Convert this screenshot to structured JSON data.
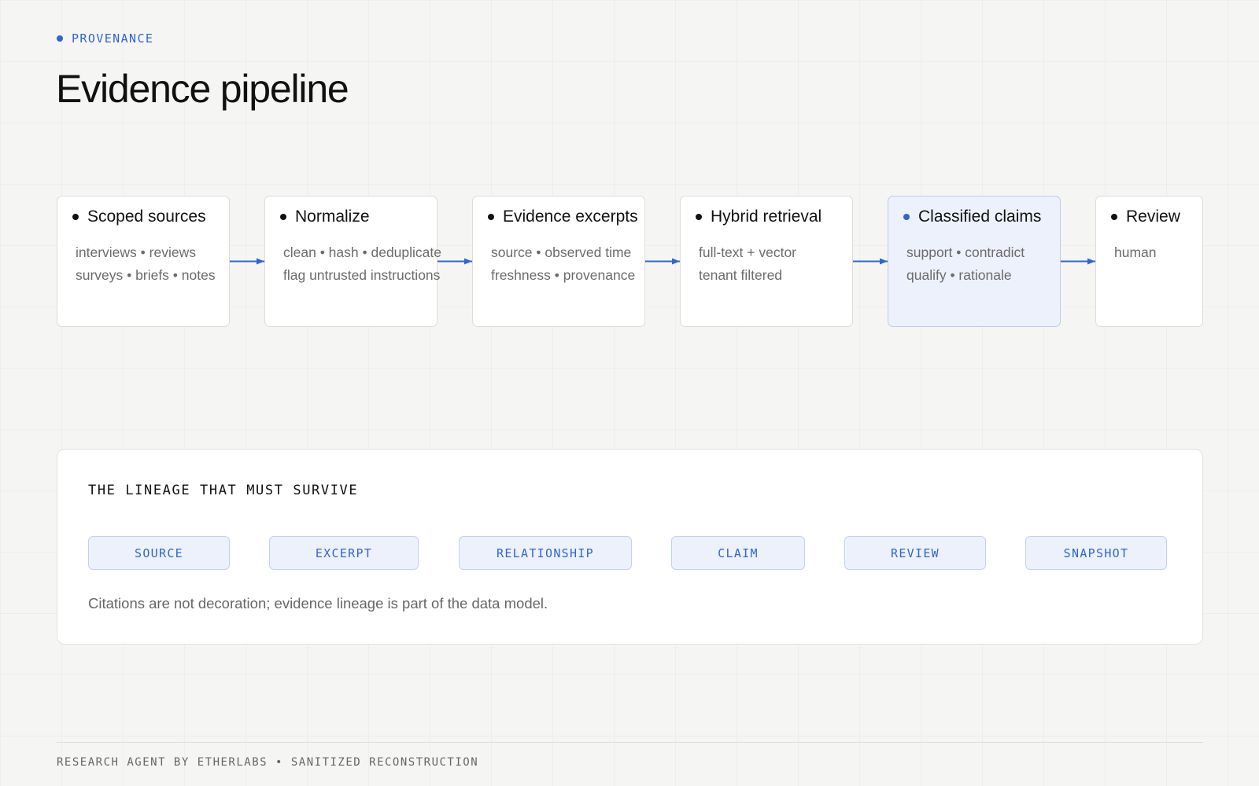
{
  "header": {
    "eyebrow": "PROVENANCE",
    "title": "Evidence pipeline"
  },
  "pipeline": {
    "stages": [
      {
        "name": "Scoped sources",
        "lines": [
          "interviews • reviews",
          "surveys • briefs • notes"
        ],
        "highlighted": false
      },
      {
        "name": "Normalize",
        "lines": [
          "clean • hash • deduplicate",
          "flag untrusted instructions"
        ],
        "highlighted": false
      },
      {
        "name": "Evidence excerpts",
        "lines": [
          "source • observed time",
          "freshness • provenance"
        ],
        "highlighted": false
      },
      {
        "name": "Hybrid retrieval",
        "lines": [
          "full-text + vector",
          "tenant filtered"
        ],
        "highlighted": false
      },
      {
        "name": "Classified claims",
        "lines": [
          "support • contradict",
          "qualify • rationale"
        ],
        "highlighted": true
      },
      {
        "name": "Review",
        "lines": [
          "human"
        ],
        "highlighted": false
      }
    ]
  },
  "lineage": {
    "title": "THE LINEAGE THAT MUST SURVIVE",
    "chips": [
      "SOURCE",
      "EXCERPT",
      "RELATIONSHIP",
      "CLAIM",
      "REVIEW",
      "SNAPSHOT"
    ],
    "note": "Citations are not decoration; evidence lineage is part of the data model."
  },
  "footer": {
    "text": "RESEARCH AGENT BY ETHERLABS • SANITIZED RECONSTRUCTION"
  },
  "colors": {
    "accent": "#2f66d0",
    "highlight_fill": "#edf1fb",
    "background": "#f5f5f3"
  }
}
